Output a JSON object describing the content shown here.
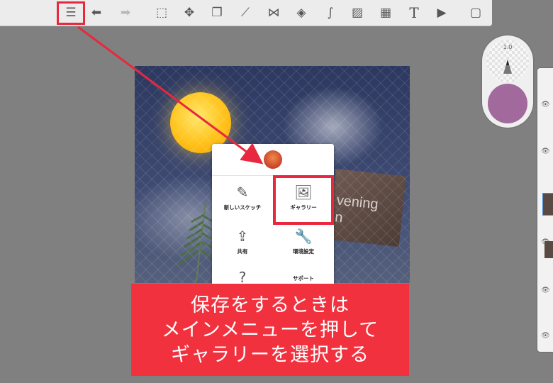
{
  "toolbar": {
    "buttons": [
      {
        "name": "main-menu-button",
        "icon": "list-icon",
        "glyph": "☰"
      },
      {
        "name": "undo-button",
        "icon": "undo-arrow-icon",
        "glyph": "⬅"
      },
      {
        "name": "redo-button",
        "icon": "redo-arrow-icon",
        "glyph": "➡"
      },
      {
        "name": "select-button",
        "icon": "selection-icon",
        "glyph": "⬚"
      },
      {
        "name": "transform-button",
        "icon": "move-icon",
        "glyph": "✥"
      },
      {
        "name": "copy-button",
        "icon": "copy-layer-icon",
        "glyph": "❐"
      },
      {
        "name": "ruler-button",
        "icon": "ruler-icon",
        "glyph": "⟋"
      },
      {
        "name": "symmetry-button",
        "icon": "symmetry-icon",
        "glyph": "⋈"
      },
      {
        "name": "shape-button",
        "icon": "shapes-icon",
        "glyph": "◈"
      },
      {
        "name": "curve-button",
        "icon": "curve-icon",
        "glyph": "∫"
      },
      {
        "name": "image-button",
        "icon": "add-image-icon",
        "glyph": "▨"
      },
      {
        "name": "perspective-button",
        "icon": "perspective-grid-icon",
        "glyph": "▦"
      },
      {
        "name": "text-button",
        "icon": "text-icon",
        "glyph": "T"
      },
      {
        "name": "video-button",
        "icon": "video-icon",
        "glyph": "▶"
      },
      {
        "name": "fullscreen-button",
        "icon": "fullscreen-icon",
        "glyph": "▢"
      }
    ]
  },
  "brush": {
    "size": "1.0",
    "color": "#a26a9c"
  },
  "canvas": {
    "sign_line1": "vening",
    "sign_line2": "n"
  },
  "menu": {
    "items": [
      {
        "label": "新しいスケッチ",
        "icon": "new-sketch-icon",
        "glyph": "✎"
      },
      {
        "label": "ギャラリー",
        "icon": "gallery-icon",
        "glyph": "🖼"
      },
      {
        "label": "共有",
        "icon": "share-icon",
        "glyph": "⇪"
      },
      {
        "label": "環境設定",
        "icon": "wrench-icon",
        "glyph": "🔧"
      },
      {
        "label": "",
        "icon": "help-icon",
        "glyph": "?"
      },
      {
        "label": "サポート",
        "icon": "support-icon",
        "glyph": ""
      }
    ]
  },
  "banner": {
    "line1": "保存をするときは",
    "line2": "メインメニューを押して",
    "line3": "ギャラリーを選択する"
  },
  "colors": {
    "highlight": "#e8283e",
    "banner": "#f2313f"
  }
}
